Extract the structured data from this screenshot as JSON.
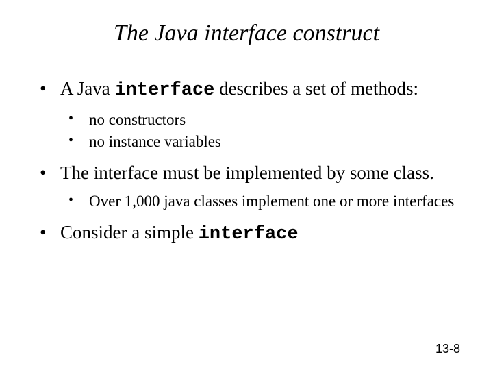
{
  "title": "The Java interface construct",
  "bullets": [
    {
      "pre": "A Java ",
      "code": "interface",
      "post": " describes a set of methods:",
      "sub": [
        "no constructors",
        "no instance variables"
      ]
    },
    {
      "pre": "The interface must be implemented by some class.",
      "code": "",
      "post": "",
      "sub": [
        "Over 1,000 java classes implement one or more interfaces"
      ]
    },
    {
      "pre": "Consider a simple ",
      "code": "interface",
      "post": "",
      "sub": []
    }
  ],
  "page_number": "13-8"
}
